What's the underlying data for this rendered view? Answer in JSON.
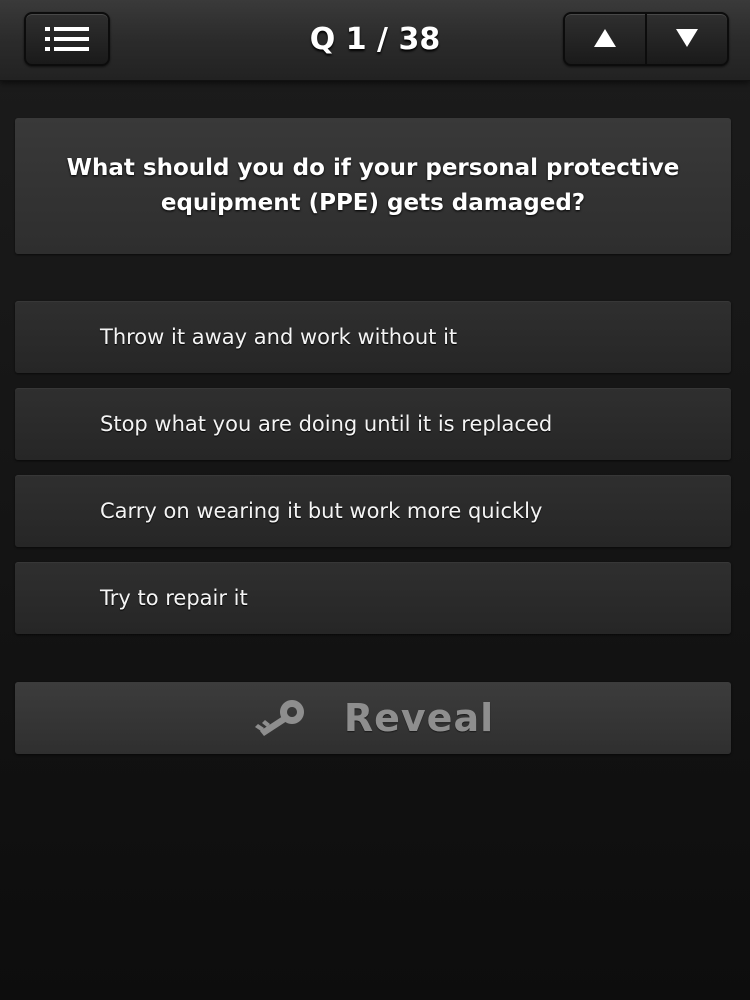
{
  "header": {
    "counter": "Q 1 / 38",
    "menu_icon": "list-icon",
    "prev_icon": "triangle-up-icon",
    "next_icon": "triangle-down-icon"
  },
  "question": {
    "text": "What should you do if your personal protective equipment (PPE) gets damaged?"
  },
  "answers": [
    {
      "label": "Throw it away and work without it"
    },
    {
      "label": "Stop what you are doing until it is replaced"
    },
    {
      "label": "Carry on wearing it but work more quickly"
    },
    {
      "label": "Try to repair it"
    }
  ],
  "reveal": {
    "label": "Reveal",
    "icon": "key-icon"
  },
  "colors": {
    "background": "#141414",
    "topbar": "#2b2b2b",
    "card": "#333333",
    "reveal_text": "#8e8e8e"
  }
}
